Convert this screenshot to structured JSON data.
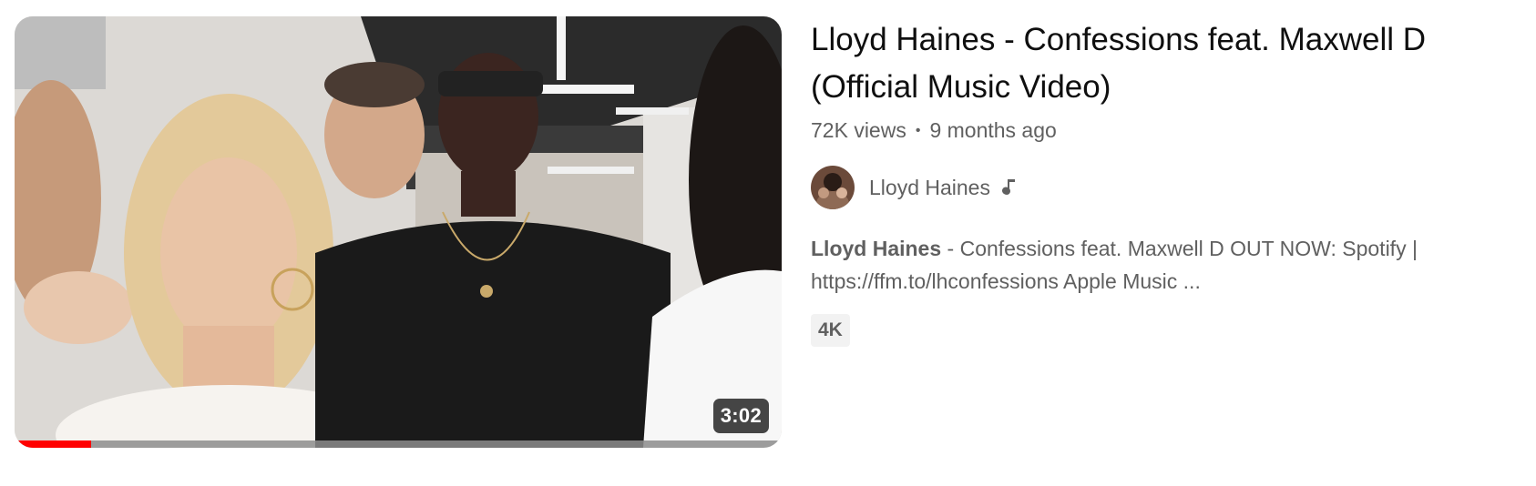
{
  "video": {
    "title": "Lloyd Haines - Confessions feat. Maxwell D (Official Music Video)",
    "views": "72K views",
    "separator": "•",
    "age": "9 months ago",
    "duration": "3:02",
    "watch_progress_percent": 10
  },
  "channel": {
    "name": "Lloyd Haines",
    "badge_icon": "music-note-icon",
    "avatar_icon": "channel-avatar"
  },
  "description": {
    "highlight": "Lloyd Haines",
    "text": " - Confessions feat. Maxwell D OUT NOW: Spotify | https://ffm.to/lhconfessions Apple Music ..."
  },
  "badges": [
    "4K"
  ],
  "colors": {
    "progress": "#ff0000",
    "secondary_text": "#606060",
    "primary_text": "#0f0f0f"
  }
}
